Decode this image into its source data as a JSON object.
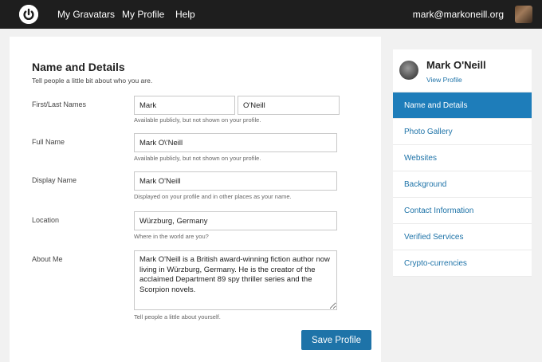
{
  "topbar": {
    "nav": [
      {
        "label": "My Gravatars"
      },
      {
        "label": "My Profile"
      },
      {
        "label": "Help"
      }
    ],
    "user_email": "mark@markoneill.org"
  },
  "form": {
    "title": "Name and Details",
    "subtitle": "Tell people a little bit about who you are.",
    "first_last_label": "First/Last Names",
    "first_name": "Mark",
    "last_name": "O'Neill",
    "first_last_hint": "Available publicly, but not shown on your profile.",
    "full_name_label": "Full Name",
    "full_name": "Mark O\\'Neill",
    "full_name_hint": "Available publicly, but not shown on your profile.",
    "display_name_label": "Display Name",
    "display_name": "Mark O'Neill",
    "display_name_hint": "Displayed on your profile and in other places as your name.",
    "location_label": "Location",
    "location": "Würzburg, Germany",
    "location_hint": "Where in the world are you?",
    "about_label": "About Me",
    "about": "Mark O'Neill is a British award-winning fiction author now living in Würzburg, Germany. He is the creator of the acclaimed Department 89 spy thriller series and the Scorpion novels.",
    "about_hint": "Tell people a little about yourself.",
    "save_label": "Save Profile"
  },
  "sidebar": {
    "profile_name": "Mark O'Neill",
    "view_profile": "View Profile",
    "items": [
      {
        "label": "Name and Details",
        "active": true
      },
      {
        "label": "Photo Gallery"
      },
      {
        "label": "Websites"
      },
      {
        "label": "Background"
      },
      {
        "label": "Contact Information"
      },
      {
        "label": "Verified Services"
      },
      {
        "label": "Crypto-currencies"
      }
    ]
  },
  "colors": {
    "accent": "#1e73a8",
    "active_menu": "#1e7dba",
    "topbar": "#1e1e1e"
  }
}
